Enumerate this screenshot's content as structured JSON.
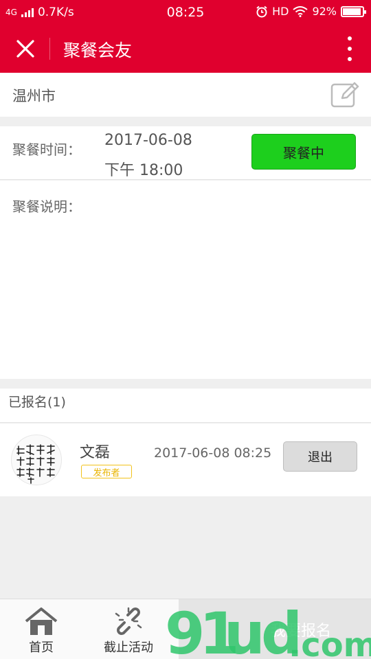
{
  "status_bar": {
    "network": "4G",
    "speed": "0.7K/s",
    "time": "08:25",
    "hd": "HD",
    "battery_percent": "92%",
    "battery_level": 0.92
  },
  "titlebar": {
    "title": "聚餐会友",
    "close_icon": "close-icon",
    "more_icon": "more-vertical-icon"
  },
  "location": {
    "city": "温州市",
    "edit_icon": "edit-icon"
  },
  "event": {
    "time_label": "聚餐时间：",
    "date": "2017-06-08",
    "time": "下午 18:00",
    "status_label": "聚餐中",
    "description_label": "聚餐说明：",
    "status_color": "#1dcf1d"
  },
  "signed_up": {
    "header": "已报名(1)",
    "members": [
      {
        "name": "文磊",
        "role_badge": "发布者",
        "signup_time": "2017-06-08 08:25",
        "quit_label": "退出"
      }
    ]
  },
  "bottom_nav": {
    "home_label": "首页",
    "stop_label": "截止活动",
    "signup_label": "我要报名",
    "home_icon": "home-icon",
    "stop_icon": "broken-link-icon"
  },
  "colors": {
    "brand_red": "#e0002e"
  }
}
